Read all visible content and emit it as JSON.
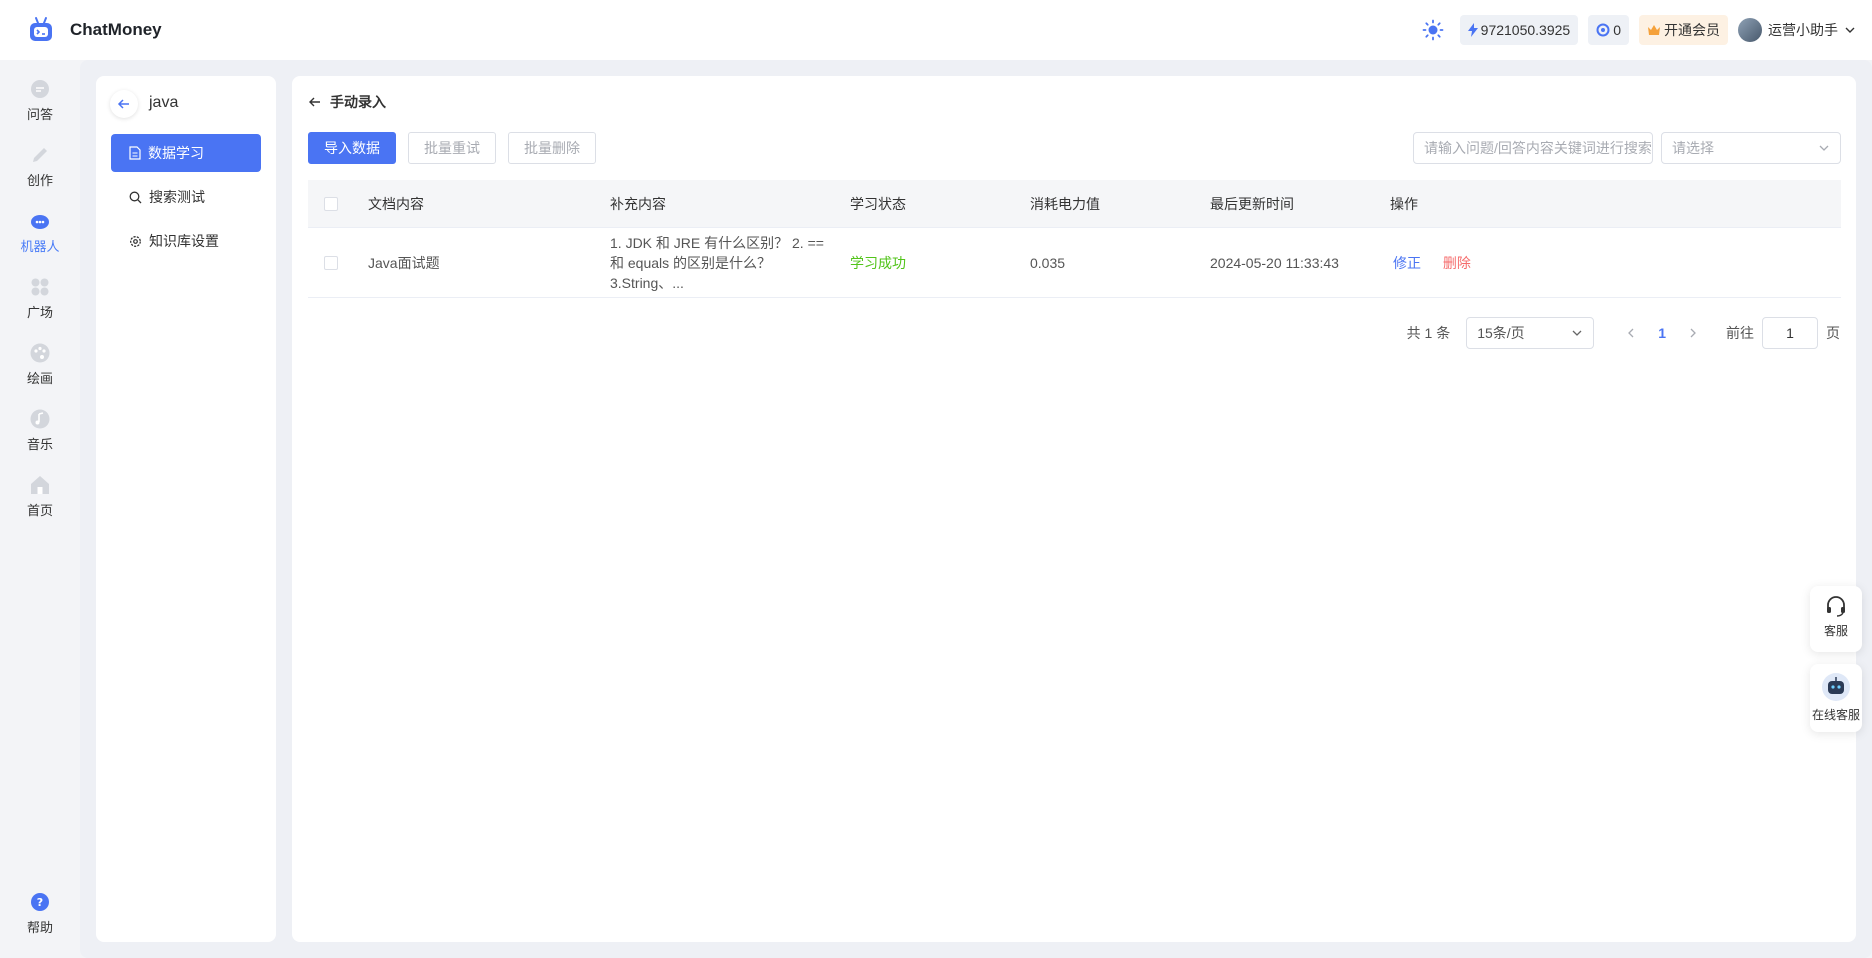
{
  "app": {
    "title": "ChatMoney"
  },
  "header": {
    "balance": "9721050.3925",
    "tokens": "0",
    "vip_label": "开通会员",
    "user_name": "运营小助手"
  },
  "rail": {
    "items": [
      {
        "label": "问答",
        "icon": "chat-icon"
      },
      {
        "label": "创作",
        "icon": "pen-icon"
      },
      {
        "label": "机器人",
        "icon": "robot-icon"
      },
      {
        "label": "广场",
        "icon": "grid-icon"
      },
      {
        "label": "绘画",
        "icon": "palette-icon"
      },
      {
        "label": "音乐",
        "icon": "music-icon"
      },
      {
        "label": "首页",
        "icon": "home-icon"
      }
    ],
    "help_label": "帮助"
  },
  "kb": {
    "name": "java",
    "menu": [
      {
        "label": "数据学习",
        "icon": "document-icon"
      },
      {
        "label": "搜索测试",
        "icon": "search-icon"
      },
      {
        "label": "知识库设置",
        "icon": "gear-icon"
      }
    ]
  },
  "content": {
    "crumb": "手动录入",
    "toolbar": {
      "import": "导入数据",
      "retry": "批量重试",
      "delete": "批量删除"
    },
    "search_placeholder": "请输入问题/回答内容关键词进行搜索",
    "select_placeholder": "请选择",
    "table": {
      "headers": [
        "文档内容",
        "补充内容",
        "学习状态",
        "消耗电力值",
        "最后更新时间",
        "操作"
      ],
      "rows": [
        {
          "doc": "Java面试题",
          "supplement": "1. JDK 和 JRE 有什么区别？ 2. == 和 equals 的区别是什么？ 3.String、...",
          "status": "学习成功",
          "cost": "0.035",
          "updated": "2024-05-20 11:33:43",
          "edit": "修正",
          "delete": "删除"
        }
      ]
    },
    "pagination": {
      "total": "共 1 条",
      "page_size": "15条/页",
      "current": "1",
      "goto_prefix": "前往",
      "goto_value": "1",
      "goto_suffix": "页"
    }
  },
  "floating": {
    "service": "客服",
    "online_service": "在线客服"
  },
  "colors": {
    "accent": "#4a74f3",
    "success": "#52c41a",
    "danger": "#f56c6c"
  }
}
